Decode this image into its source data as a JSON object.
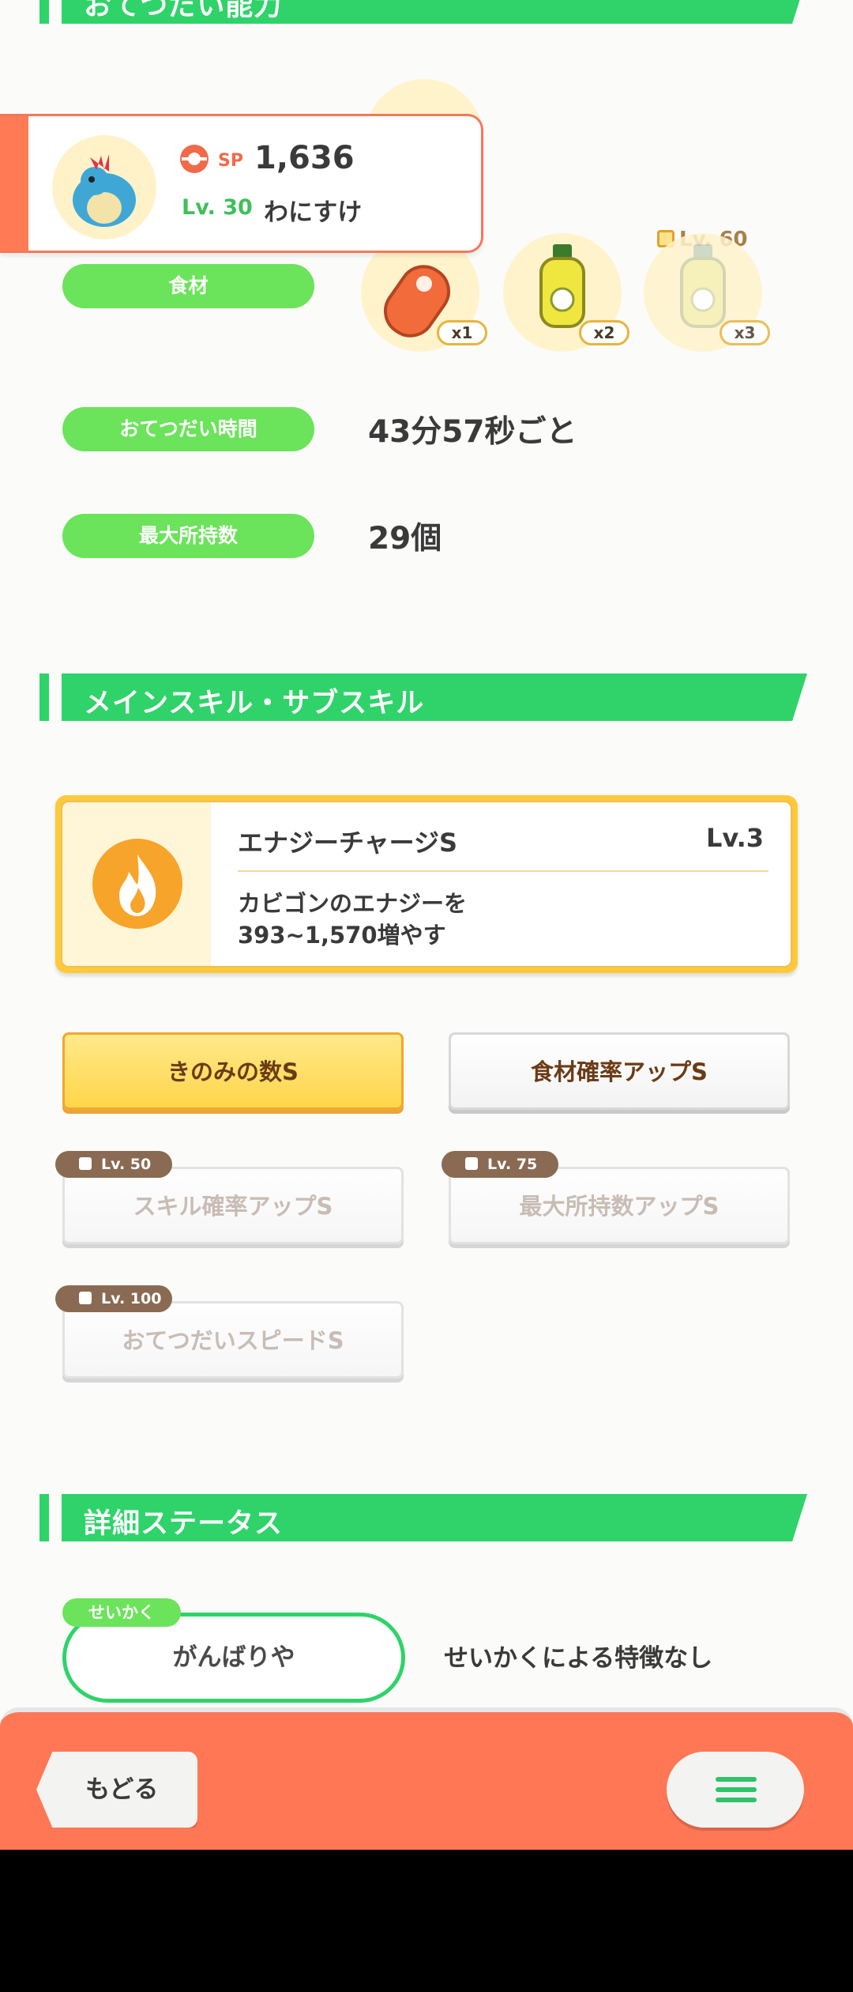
{
  "header_section": {
    "title": "おてつだい能力"
  },
  "pokemon": {
    "sp_label": "SP",
    "sp_value": "1,636",
    "level": "Lv. 30",
    "name": "わにすけ"
  },
  "ingredients": {
    "label": "食材",
    "items": [
      {
        "icon": "sausage-icon",
        "count": "x1"
      },
      {
        "icon": "oil-bottle-icon",
        "count": "x2"
      },
      {
        "icon": "oil-bottle-icon",
        "count": "x3",
        "locked": true,
        "unlock_level": "Lv. 60"
      }
    ]
  },
  "help_time": {
    "label": "おてつだい時間",
    "value": "43分57秒ごと"
  },
  "max_carry": {
    "label": "最大所持数",
    "value": "29個"
  },
  "skills_section": {
    "title": "メインスキル・サブスキル"
  },
  "main_skill": {
    "name": "エナジーチャージS",
    "level": "Lv.3",
    "desc_line1": "カビゴンのエナジーを",
    "desc_line2": "393~1,570増やす",
    "icon": "fire-icon"
  },
  "sub_skills": [
    {
      "label": "きのみの数S",
      "state": "active"
    },
    {
      "label": "食材確率アップS",
      "state": "normal"
    },
    {
      "label": "スキル確率アップS",
      "state": "locked",
      "unlock": "Lv. 50"
    },
    {
      "label": "最大所持数アップS",
      "state": "locked",
      "unlock": "Lv. 75"
    },
    {
      "label": "おてつだいスピードS",
      "state": "locked",
      "unlock": "Lv. 100"
    }
  ],
  "detail_section": {
    "title": "詳細ステータス"
  },
  "nature": {
    "tag": "せいかく",
    "value": "がんばりや",
    "effect": "せいかくによる特徴なし"
  },
  "bottom": {
    "back_label": "もどる"
  },
  "colors": {
    "accent_green": "#2fd36a",
    "bottom_bar": "#ff7755",
    "skill_gold": "#ffc93c"
  }
}
